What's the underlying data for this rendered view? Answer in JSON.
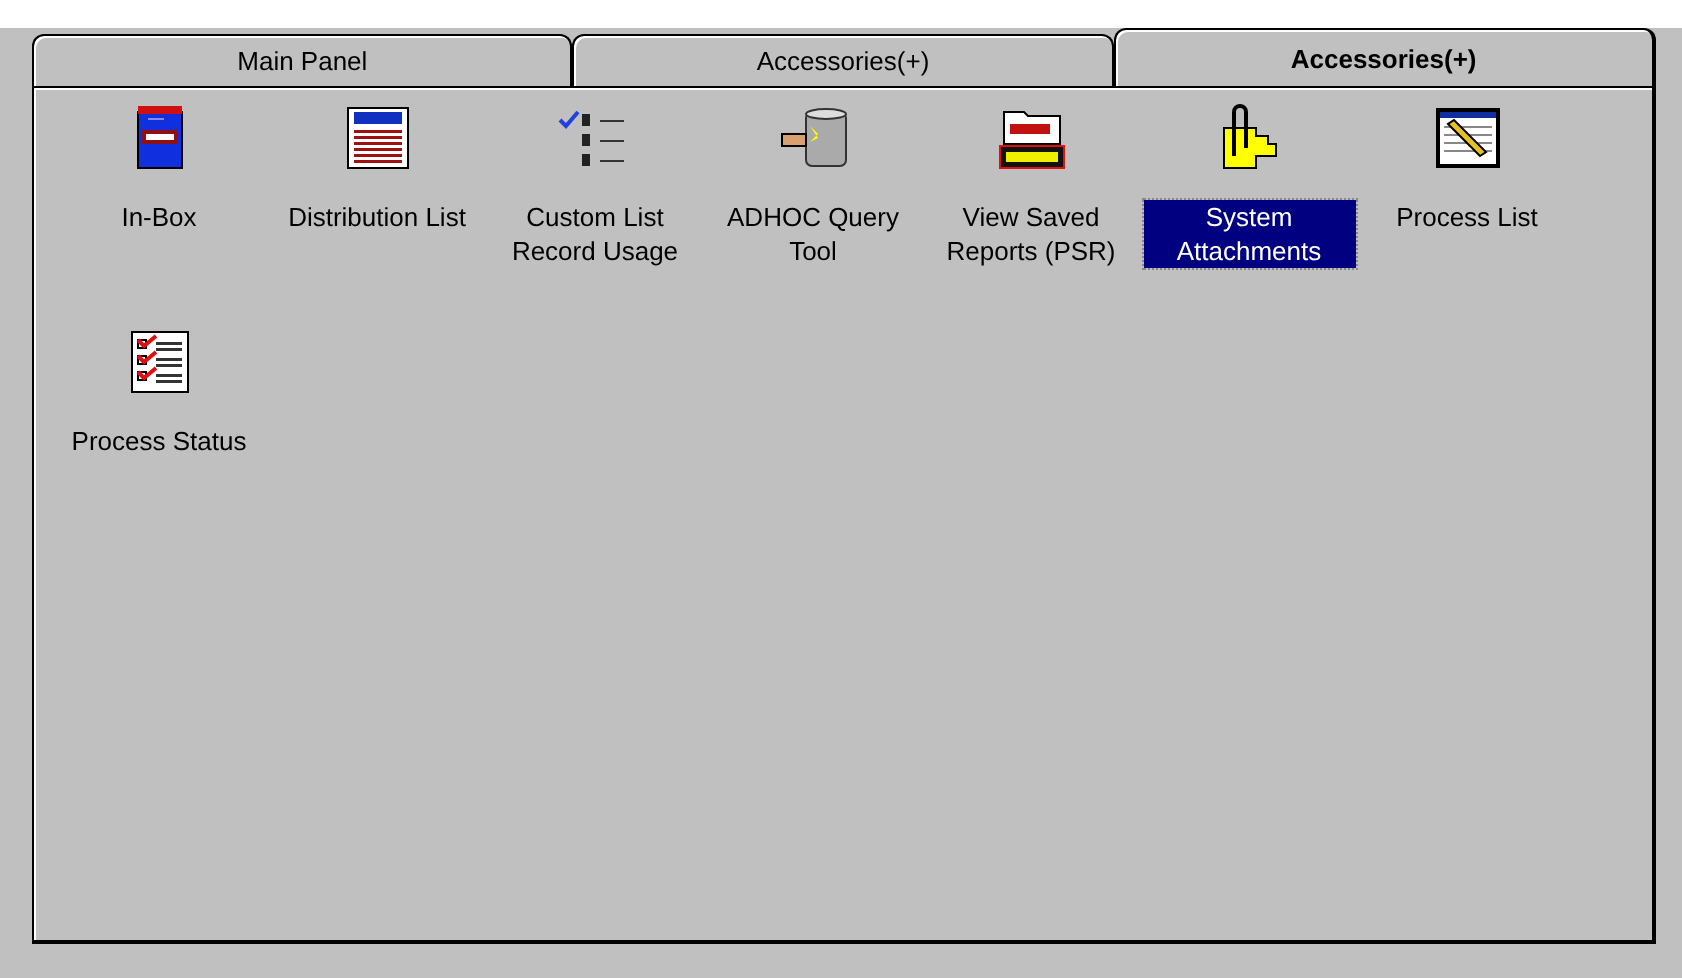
{
  "tabs": [
    {
      "label": "Main Panel",
      "selected": false
    },
    {
      "label": "Accessories(+)",
      "selected": false
    },
    {
      "label": "Accessories(+)",
      "selected": true
    }
  ],
  "items": [
    {
      "kind": "mailbox",
      "label": "In-Box",
      "selected": false
    },
    {
      "kind": "list",
      "label": "Distribution List",
      "selected": false
    },
    {
      "kind": "numbered",
      "label": "Custom List Record Usage",
      "selected": false
    },
    {
      "kind": "query",
      "label": "ADHOC Query Tool",
      "selected": false
    },
    {
      "kind": "folder",
      "label": "View Saved Reports (PSR)",
      "selected": false
    },
    {
      "kind": "clip",
      "label": "System Attachments",
      "selected": true
    },
    {
      "kind": "window",
      "label": "Process List",
      "selected": false
    },
    {
      "kind": "checklist",
      "label": "Process Status",
      "selected": false
    }
  ]
}
